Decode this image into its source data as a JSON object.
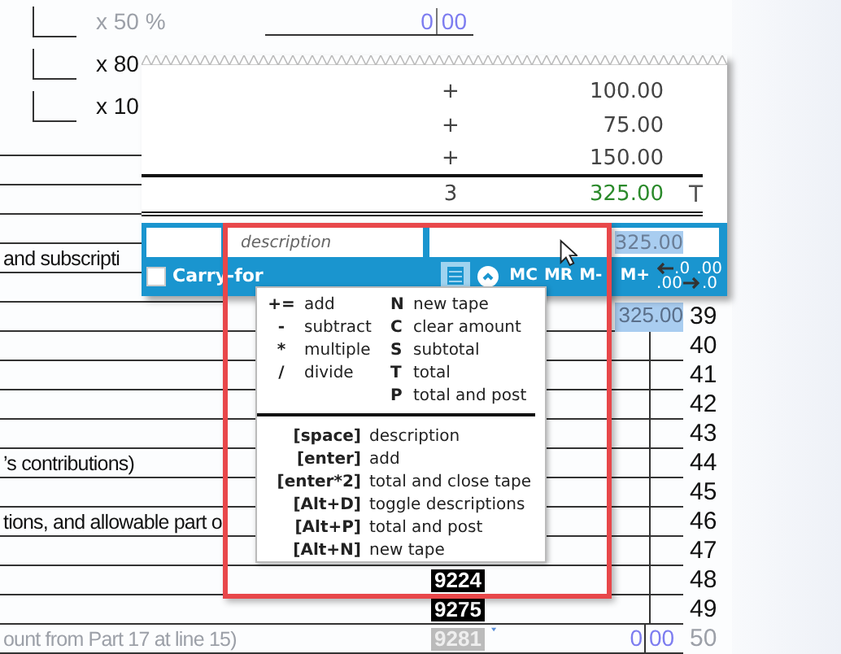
{
  "form": {
    "percent_rows": [
      {
        "label": "x 50 %",
        "faded": true,
        "amount": {
          "whole": "0",
          "cents": "00"
        }
      },
      {
        "label": "x 80",
        "faded": false
      },
      {
        "label": "x 10",
        "faded": false
      }
    ],
    "heading_text": "and subscripti",
    "rows": [
      {
        "line": "39",
        "amount": "325.00",
        "highlighted": true
      },
      {
        "line": "40"
      },
      {
        "line": "41"
      },
      {
        "line": "42"
      },
      {
        "line": "43"
      },
      {
        "line": "44",
        "text": "’s contributions)"
      },
      {
        "line": "45"
      },
      {
        "line": "46",
        "text": "tions, and allowable part o"
      },
      {
        "line": "47"
      },
      {
        "line": "48",
        "badge": "9224"
      },
      {
        "line": "49",
        "badge": "9275"
      },
      {
        "line": "50",
        "badge": "9281",
        "faded": true,
        "dropdown": true,
        "text": "ount from Part 17 at line 15)",
        "split_amount": {
          "whole": "0",
          "cents": "00"
        }
      }
    ]
  },
  "tape": {
    "entries": [
      {
        "op": "+",
        "amount": "100.00"
      },
      {
        "op": "+",
        "amount": "75.00"
      },
      {
        "op": "+",
        "amount": "150.00"
      }
    ],
    "total": {
      "count": "3",
      "amount": "325.00",
      "mark": "T"
    },
    "description_placeholder": "description",
    "amount_value": "325.00",
    "carry_forward": {
      "label": "Carry-for",
      "checked": false
    },
    "memory_buttons": [
      "MC",
      "MR",
      "M-",
      "M+"
    ],
    "decimals": {
      "less": [
        ".0",
        ".00"
      ],
      "more": [
        ".00",
        ".0"
      ]
    }
  },
  "help": {
    "operators": [
      {
        "key": "+=",
        "desc": "add"
      },
      {
        "key": "-",
        "desc": "subtract"
      },
      {
        "key": "*",
        "desc": "multiple"
      },
      {
        "key": "/",
        "desc": "divide"
      }
    ],
    "letters": [
      {
        "key": "N",
        "desc": "new tape"
      },
      {
        "key": "C",
        "desc": "clear amount"
      },
      {
        "key": "S",
        "desc": "subtotal"
      },
      {
        "key": "T",
        "desc": "total"
      },
      {
        "key": "P",
        "desc": "total and post"
      }
    ],
    "shortcuts": [
      {
        "key": "[space]",
        "desc": "description"
      },
      {
        "key": "[enter]",
        "desc": "add"
      },
      {
        "key": "[enter*2]",
        "desc": "total and close tape"
      },
      {
        "key": "[Alt+D]",
        "desc": "toggle descriptions"
      },
      {
        "key": "[Alt+P]",
        "desc": "total and post"
      },
      {
        "key": "[Alt+N]",
        "desc": "new tape"
      }
    ]
  }
}
